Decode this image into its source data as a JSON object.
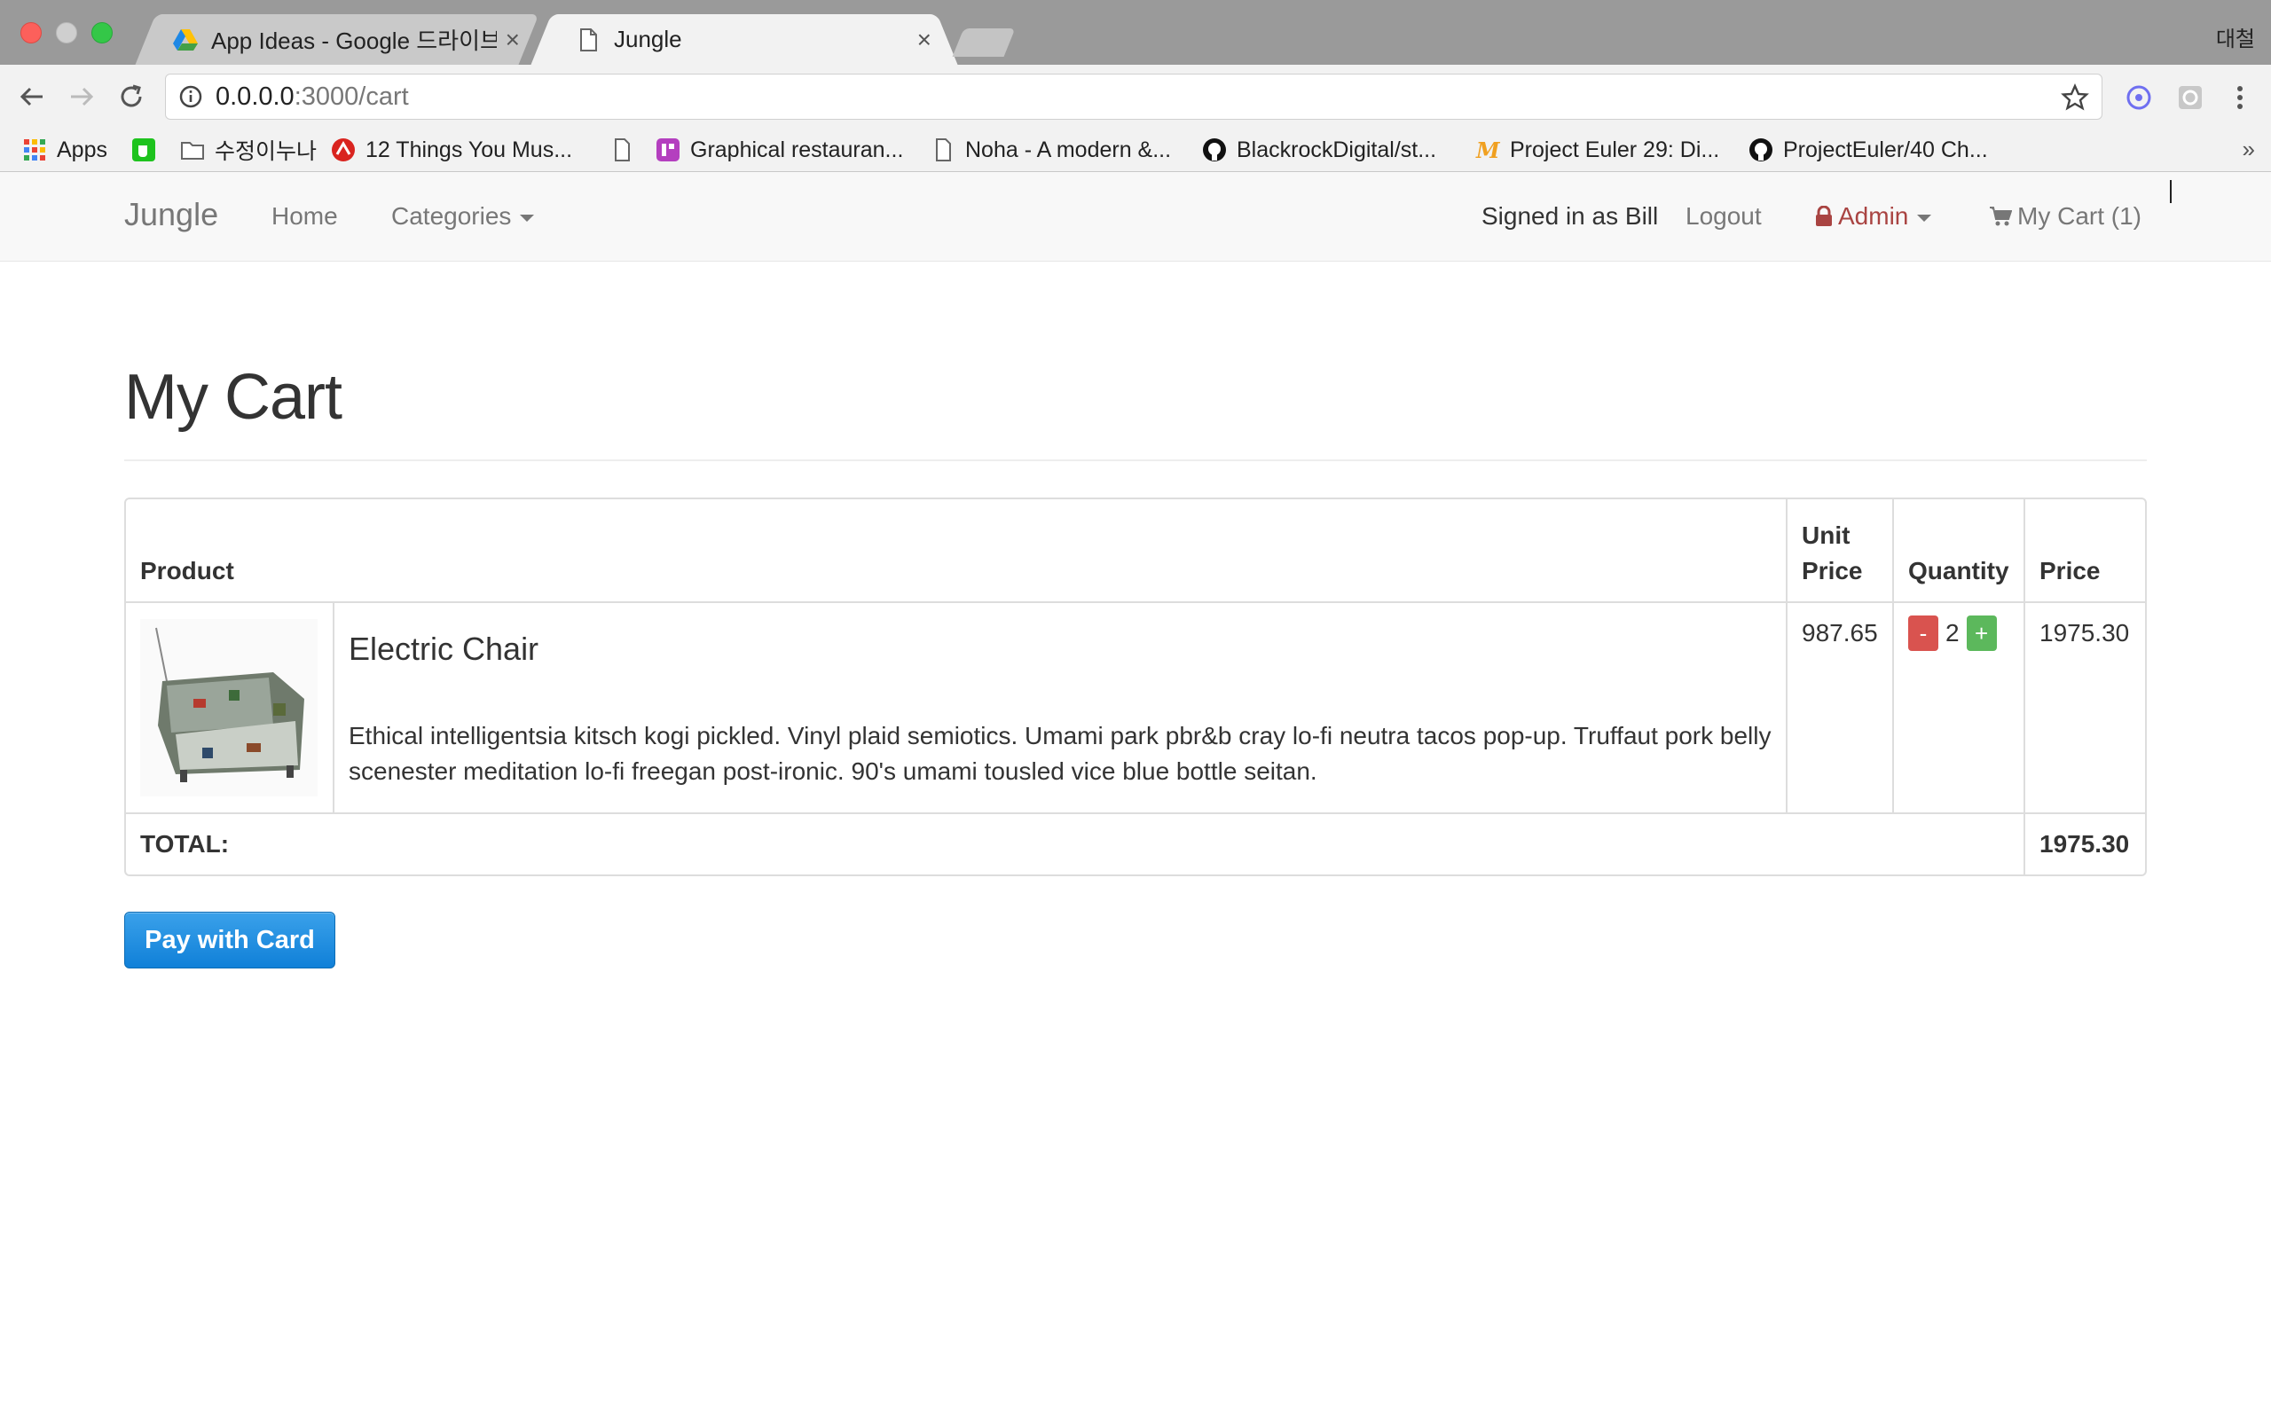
{
  "browser": {
    "tabs": [
      {
        "title": "App Ideas - Google 드라이브",
        "close": "×",
        "icon": "google-drive-icon"
      },
      {
        "title": "Jungle",
        "close": "×",
        "icon": "page-icon"
      }
    ],
    "profile": "대철",
    "address": {
      "host": "0.0.0.0",
      "path": ":3000/cart"
    },
    "bookmarks": [
      {
        "label": "Apps",
        "icon": "apps-grid-icon"
      },
      {
        "label": "",
        "icon": "green-cup-icon"
      },
      {
        "label": "수정이누나",
        "icon": "folder-icon"
      },
      {
        "label": "12 Things You Mus...",
        "icon": "red-logo-icon"
      },
      {
        "label": "",
        "icon": "page-icon"
      },
      {
        "label": "Graphical restauran...",
        "icon": "purple-app-icon"
      },
      {
        "label": "Noha - A modern &...",
        "icon": "page-icon"
      },
      {
        "label": "BlackrockDigital/st...",
        "icon": "github-icon"
      },
      {
        "label": "Project Euler 29: Di...",
        "icon": "orange-m-icon"
      },
      {
        "label": "ProjectEuler/40 Ch...",
        "icon": "github-icon"
      }
    ],
    "more": "»"
  },
  "nav": {
    "brand": "Jungle",
    "home": "Home",
    "categories": "Categories",
    "signed_in": "Signed in as Bill",
    "logout": "Logout",
    "admin": "Admin",
    "cart": "My Cart (1)"
  },
  "page": {
    "title": "My Cart"
  },
  "table": {
    "headers": {
      "product": "Product",
      "unit_price": "Unit Price",
      "quantity": "Quantity",
      "price": "Price"
    },
    "items": [
      {
        "name": "Electric Chair",
        "description": "Ethical intelligentsia kitsch kogi pickled. Vinyl plaid semiotics. Umami park pbr&b cray lo-fi neutra tacos pop-up. Truffaut pork belly scenester meditation lo-fi freegan post-ironic. 90's umami tousled vice blue bottle seitan.",
        "unit_price": "987.65",
        "quantity": "2",
        "minus": "-",
        "plus": "+",
        "price": "1975.30"
      }
    ],
    "total_label": "TOTAL:",
    "total_value": "1975.30"
  },
  "pay_button": "Pay with Card",
  "colors": {
    "admin": "#a94442",
    "minus": "#d9534f",
    "plus": "#5cb85c",
    "pay": "#1a8ae0"
  }
}
